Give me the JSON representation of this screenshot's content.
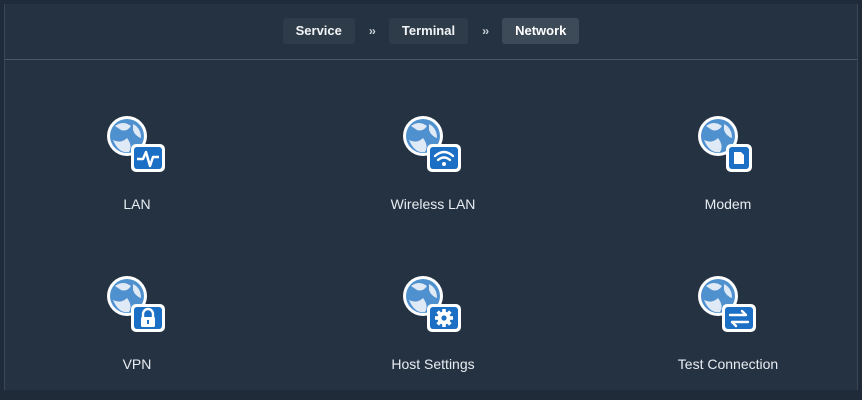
{
  "breadcrumb": {
    "items": [
      "Service",
      "Terminal",
      "Network"
    ],
    "separator": "››"
  },
  "tiles": [
    {
      "label": "LAN",
      "icon": "lan-icon"
    },
    {
      "label": "Wireless LAN",
      "icon": "wireless-lan-icon"
    },
    {
      "label": "Modem",
      "icon": "modem-icon"
    },
    {
      "label": "VPN",
      "icon": "vpn-icon"
    },
    {
      "label": "Host Settings",
      "icon": "host-settings-icon"
    },
    {
      "label": "Test Connection",
      "icon": "test-connection-icon"
    }
  ],
  "colors": {
    "background": "#253241",
    "badge": "#1b6fc4",
    "globe": "#4f90cf"
  }
}
